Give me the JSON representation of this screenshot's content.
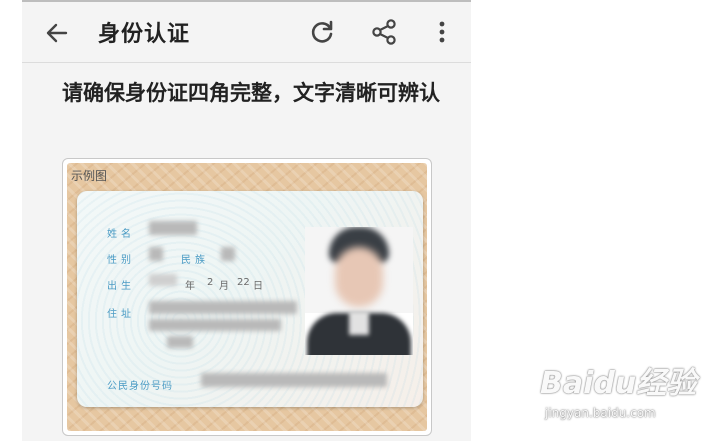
{
  "appbar": {
    "title": "身份认证",
    "back_icon": "arrow-left-icon",
    "refresh_icon": "refresh-icon",
    "share_icon": "share-icon",
    "more_icon": "more-vertical-icon"
  },
  "instruction": "请确保身份证四角完整，文字清晰可辨认",
  "sample": {
    "label": "示例图",
    "card": {
      "name_label": "姓名",
      "gender_label": "性别",
      "ethnicity_label": "民族",
      "birth_label": "出生",
      "birth_year_suffix": "年",
      "birth_month": "2",
      "birth_month_suffix": "月",
      "birth_day": "22",
      "birth_day_suffix": "日",
      "address_label": "住址",
      "id_number_label": "公民身份号码"
    }
  },
  "watermark": {
    "logo": "Baidu经验",
    "url": "jingyan.baidu.com"
  },
  "colors": {
    "field_label": "#4a9bc4",
    "text": "#222222",
    "background": "#f4f4f4"
  }
}
